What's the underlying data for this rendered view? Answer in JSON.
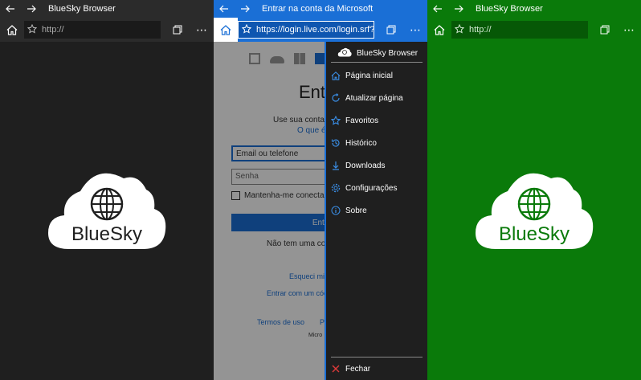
{
  "panels": {
    "dark": {
      "title": "BlueSky Browser",
      "address": "http://",
      "logo_text": "BlueSky"
    },
    "blue": {
      "title": "Entrar na conta da Microsoft",
      "address": "https://login.live.com/login.srf?wa=ws",
      "login": {
        "heading": "Ent",
        "subtitle": "Use sua conta",
        "subtitle_link": "O que é",
        "email_placeholder": "Email ou telefone",
        "password_placeholder": "Senha",
        "keep_signed": "Mantenha-me conecta",
        "submit": "Entr",
        "no_account": "Não tem uma co",
        "forgot": "Esqueci mi",
        "sign_code": "Entrar com um cód",
        "terms": "Termos de uso",
        "privacy": "P",
        "micro": "Micro"
      },
      "menu": {
        "header": "BlueSky Browser",
        "items": [
          {
            "label": "Página inicial",
            "icon": "home-icon"
          },
          {
            "label": "Atualizar página",
            "icon": "refresh-icon"
          },
          {
            "label": "Favoritos",
            "icon": "star-icon"
          },
          {
            "label": "Histórico",
            "icon": "history-icon"
          },
          {
            "label": "Downloads",
            "icon": "download-icon"
          },
          {
            "label": "Configurações",
            "icon": "gear-icon"
          },
          {
            "label": "Sobre",
            "icon": "info-icon"
          }
        ],
        "close": "Fechar"
      }
    },
    "green": {
      "title": "BlueSky Browser",
      "address": "http://",
      "logo_text": "BlueSky"
    }
  },
  "colors": {
    "dark_bg": "#1f1f1f",
    "blue_accent": "#1a6fd6",
    "green_bg": "#0a7a0a",
    "logo_dark": "#1f1f1f",
    "logo_green": "#0a7a0a"
  }
}
